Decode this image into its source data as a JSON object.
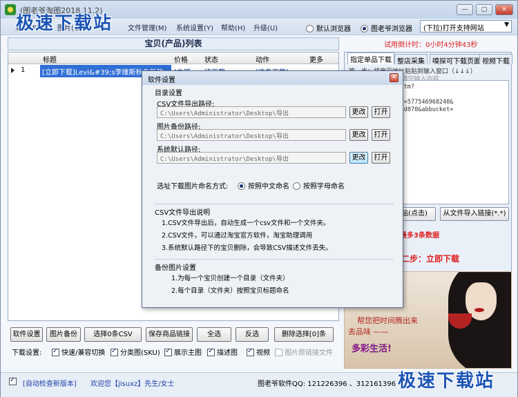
{
  "window": {
    "title": "(图老爷淘图2018.11.2)",
    "controls": [
      "—",
      "▢",
      "✕"
    ]
  },
  "menu": {
    "items": [
      "帐号(F)",
      "图片(G)",
      "文件管理(M)",
      "系统设置(Y)",
      "帮助(H)",
      "升级(U)"
    ],
    "browser_default": "默认浏览器",
    "browser_builtin": "图老爷浏览器",
    "browser_selected": "图老爷浏览器",
    "site_select": "(下拉)打开支持网站"
  },
  "main": {
    "list_title": "宝贝(产品)列表",
    "countdown": "试用倒计时：0小时4分钟43秒",
    "columns": [
      "标题",
      "价格",
      "状态",
      "动作",
      "更多"
    ],
    "rows": [
      {
        "index": "1",
        "title": "[立即下载]Levi&#39;s李维斯秋冬新款",
        "price": "[立即",
        "status": "待下载",
        "action": "[准备下载]",
        "more": "..."
      }
    ]
  },
  "right_panel": {
    "tabs": [
      "指定单品下载",
      "整店采集",
      "嗅探可下载页面",
      "视频下载"
    ],
    "active_tab": "指定单品下载",
    "hint": "第一步：将宝贝地址粘贴到输入窗口（↓↓↓）",
    "hint2": "（回车换行），或击请空输入内容",
    "url_text": "mall.com/item.htm?\n#5003-\n1620a9jE75kC&id=577546968240&\n99333839de4fa03d870&abbucket=\nshop",
    "paste_button": "粘贴(点击)",
    "import_button": "从文件导入链接(*.*)",
    "max_note": "最多3条数据",
    "step2": "第二步：立即下载"
  },
  "ad": {
    "line1": "帮您把时间腾出来",
    "line2": "去品味 ——",
    "line3": "多彩生活!"
  },
  "toolbar": {
    "buttons": [
      "软件设置",
      "图片备份",
      "选择0条CSV",
      "保存商品链接",
      "全选",
      "反选",
      "删除选择[0]条"
    ]
  },
  "download_settings": {
    "label": "下载设置:",
    "options": [
      {
        "label": "快速/兼容切换",
        "checked": true
      },
      {
        "label": "分类图(SKU)",
        "checked": true
      },
      {
        "label": "展示主图",
        "checked": true
      },
      {
        "label": "描述图",
        "checked": true
      },
      {
        "label": "视频",
        "checked": true
      },
      {
        "label": "图片原链接文件",
        "checked": false
      }
    ]
  },
  "status": {
    "auto_check": "[自动检查新版本]",
    "welcome": "欢迎您【jisuxz】先生/女士",
    "qq": "图老爷软件QQ: 121226396 、312161396"
  },
  "dialog": {
    "title": "软件设置",
    "dir_section": "目录设置",
    "csv_path_label": "CSV文件导出路径:",
    "csv_path": "C:\\Users\\Administrator\\Desktop\\导出",
    "img_backup_label": "图片备份路径:",
    "img_backup_path": "C:\\Users\\Administrator\\Desktop\\导出",
    "sys_path_label": "系统默认路径:",
    "sys_path": "C:\\Users\\Administrator\\Desktop\\导出",
    "change_btn": "更改",
    "open_btn": "打开",
    "naming_label": "选址下载图片命名方式:",
    "naming_cn": "按照中文命名",
    "naming_alpha": "按照字母命名",
    "naming_selected": "按照中文命名",
    "csv_section": "CSV文件导出说明",
    "csv_notes": [
      "1.CSV文件导出后，自动生成一个csv文件和一个文件夹。",
      "2.CSV文件，可以通过淘宝官方软件，淘宝助理调用",
      "3.系统默认路径下的宝贝删除，会导致CSV描述文件丢失。"
    ],
    "backup_section": "备份图片设置",
    "backup_notes": [
      "1.为每一个宝贝创建一个目录（文件夹）",
      "2.每个目录（文件夹）按照宝贝标题命名"
    ]
  },
  "watermark": {
    "top": "极速下载站",
    "bottom": "极速下载站"
  }
}
